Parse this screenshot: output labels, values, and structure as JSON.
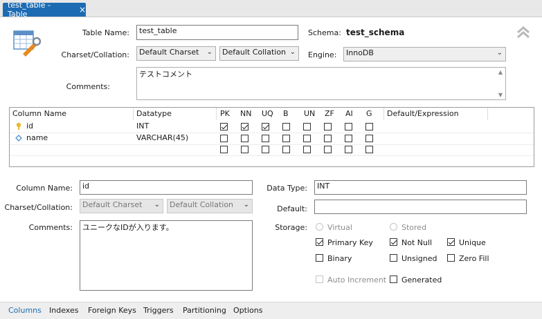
{
  "tab": {
    "title": "test_table - Table",
    "close": "×"
  },
  "table": {
    "name_label": "Table Name:",
    "name_value": "test_table",
    "schema_label": "Schema:",
    "schema_value": "test_schema",
    "charset_label": "Charset/Collation:",
    "charset_value": "Default Charset",
    "collation_value": "Default Collation",
    "engine_label": "Engine:",
    "engine_value": "InnoDB",
    "comments_label": "Comments:",
    "comments_value": "テストコメント"
  },
  "grid": {
    "headers": [
      "Column Name",
      "Datatype",
      "PK",
      "NN",
      "UQ",
      "B",
      "UN",
      "ZF",
      "AI",
      "G",
      "Default/Expression"
    ],
    "rows": [
      {
        "name": "id",
        "icon": "key-icon",
        "datatype": "INT",
        "flags": [
          true,
          true,
          true,
          false,
          false,
          false,
          false,
          false
        ]
      },
      {
        "name": "name",
        "icon": "diamond-icon",
        "datatype": "VARCHAR(45)",
        "flags": [
          false,
          false,
          false,
          false,
          false,
          false,
          false,
          false
        ]
      },
      {
        "name": "",
        "icon": "",
        "datatype": "",
        "flags": [
          false,
          false,
          false,
          false,
          false,
          false,
          false,
          false
        ]
      }
    ]
  },
  "column": {
    "name_label": "Column Name:",
    "name_value": "id",
    "charset_label": "Charset/Collation:",
    "charset_value": "Default Charset",
    "collation_value": "Default Collation",
    "comments_label": "Comments:",
    "comments_value": "ユニークなIDが入ります。",
    "datatype_label": "Data Type:",
    "datatype_value": "INT",
    "default_label": "Default:",
    "default_value": "",
    "storage_label": "Storage:",
    "virtual_label": "Virtual",
    "stored_label": "Stored",
    "primary_key_label": "Primary Key",
    "primary_key": true,
    "not_null_label": "Not Null",
    "not_null": true,
    "unique_label": "Unique",
    "unique": true,
    "binary_label": "Binary",
    "binary": false,
    "unsigned_label": "Unsigned",
    "unsigned": false,
    "zero_fill_label": "Zero Fill",
    "zero_fill": false,
    "auto_increment_label": "Auto Increment",
    "auto_increment": false,
    "generated_label": "Generated",
    "generated": false
  },
  "bottom_tabs": [
    "Columns",
    "Indexes",
    "Foreign Keys",
    "Triggers",
    "Partitioning",
    "Options"
  ],
  "colors": {
    "accent": "#1d6cb3"
  }
}
